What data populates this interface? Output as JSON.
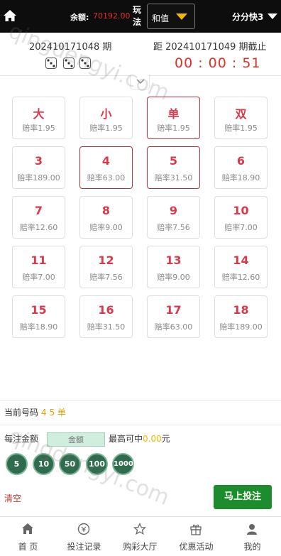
{
  "header": {
    "balance_label": "余额:",
    "balance_value": "70192.00",
    "play_label": "玩法",
    "play_mode": "和值",
    "game_name": "分分快3"
  },
  "period": {
    "current": "202410171048 期",
    "next": "距 202410171049 期截止",
    "countdown": "00 : 00 : 51",
    "dice": [
      "die-3-icon",
      "die-3-icon",
      "die-3-icon"
    ]
  },
  "cells": [
    {
      "label": "大",
      "odds": "赔率1.95",
      "selected": false
    },
    {
      "label": "小",
      "odds": "赔率1.95",
      "selected": false
    },
    {
      "label": "单",
      "odds": "赔率1.95",
      "selected": true
    },
    {
      "label": "双",
      "odds": "赔率1.95",
      "selected": false
    },
    {
      "label": "3",
      "odds": "赔率189.00",
      "selected": false
    },
    {
      "label": "4",
      "odds": "赔率63.00",
      "selected": true
    },
    {
      "label": "5",
      "odds": "赔率31.50",
      "selected": true
    },
    {
      "label": "6",
      "odds": "赔率18.90",
      "selected": false
    },
    {
      "label": "7",
      "odds": "赔率12.60",
      "selected": false
    },
    {
      "label": "8",
      "odds": "赔率9.00",
      "selected": false
    },
    {
      "label": "9",
      "odds": "赔率7.56",
      "selected": false
    },
    {
      "label": "10",
      "odds": "赔率7.00",
      "selected": false
    },
    {
      "label": "11",
      "odds": "赔率7.00",
      "selected": false
    },
    {
      "label": "12",
      "odds": "赔率7.56",
      "selected": false
    },
    {
      "label": "13",
      "odds": "赔率9.00",
      "selected": false
    },
    {
      "label": "14",
      "odds": "赔率12.60",
      "selected": false
    },
    {
      "label": "15",
      "odds": "赔率18.90",
      "selected": false
    },
    {
      "label": "16",
      "odds": "赔率31.50",
      "selected": false
    },
    {
      "label": "17",
      "odds": "赔率63.00",
      "selected": false
    },
    {
      "label": "18",
      "odds": "赔率189.00",
      "selected": false
    }
  ],
  "bet": {
    "current_label": "当前号码",
    "current_value": "4 5 单",
    "per_label": "每注金额",
    "amount_placeholder": "金额",
    "max_win_label": "最高可中",
    "max_win_value": "0.00",
    "max_win_unit": "元",
    "chips": [
      "5",
      "10",
      "50",
      "100",
      "1000"
    ],
    "clear_label": "清空",
    "submit_label": "马上投注"
  },
  "tabs": [
    {
      "label": "首 页",
      "icon": "home-icon"
    },
    {
      "label": "投注记录",
      "icon": "coin-icon"
    },
    {
      "label": "购彩大厅",
      "icon": "star-icon"
    },
    {
      "label": "优惠活动",
      "icon": "gift-icon"
    },
    {
      "label": "我的",
      "icon": "user-icon"
    }
  ],
  "watermark": "qingdengyi.com",
  "colors": {
    "accent_red": "#e0312b",
    "selected_border": "#b8343a",
    "submit_green": "#1d8c2c",
    "chip_green": "#2f6b4d"
  }
}
